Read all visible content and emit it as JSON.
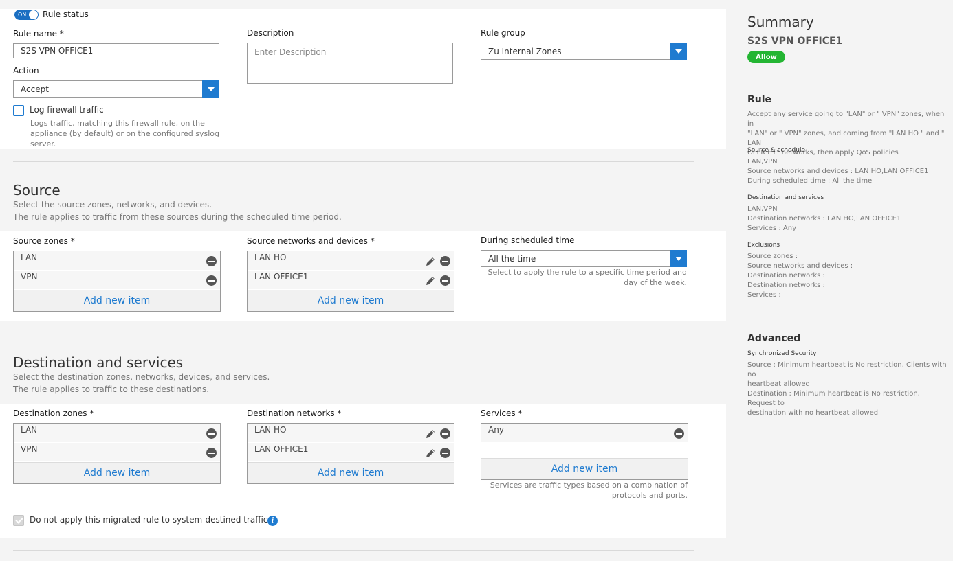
{
  "rule": {
    "status_toggle": "ON",
    "status_label": "Rule status",
    "name_label": "Rule name *",
    "name_value": "S2S VPN OFFICE1",
    "description_label": "Description",
    "description_placeholder": "Enter Description",
    "group_label": "Rule group",
    "group_value": "Zu Internal Zones",
    "action_label": "Action",
    "action_value": "Accept",
    "log_label": "Log firewall traffic",
    "log_hint": "Logs traffic, matching this firewall rule, on the appliance (by default) or on the configured syslog server."
  },
  "source": {
    "title": "Source",
    "desc1": "Select the source zones, networks, and devices.",
    "desc2": "The rule applies to traffic from these sources during the scheduled time period.",
    "zones_label": "Source zones *",
    "zones": [
      "LAN",
      "VPN"
    ],
    "networks_label": "Source networks and devices *",
    "networks": [
      "LAN HO",
      "LAN OFFICE1"
    ],
    "schedule_label": "During scheduled time",
    "schedule_value": "All the time",
    "schedule_hint1": "Select to apply the rule to a specific time period and",
    "schedule_hint2": "day of the week.",
    "add_item": "Add new item"
  },
  "destination": {
    "title": "Destination and services",
    "desc1": "Select the destination zones, networks, devices, and services.",
    "desc2": "The rule applies to traffic to these destinations.",
    "zones_label": "Destination zones *",
    "zones": [
      "LAN",
      "VPN"
    ],
    "networks_label": "Destination networks *",
    "networks": [
      "LAN HO",
      "LAN OFFICE1"
    ],
    "services_label": "Services *",
    "services": [
      "Any"
    ],
    "services_hint1": "Services are traffic types based on a combination of",
    "services_hint2": "protocols and ports.",
    "add_item": "Add new item",
    "migrated_label": "Do not apply this migrated rule to system-destined traffic.",
    "info_glyph": "i"
  },
  "summary": {
    "title": "Summary",
    "rule_name": "S2S VPN OFFICE1",
    "badge": "Allow",
    "rule_heading": "Rule",
    "rule_text": [
      "Accept any service going to \"LAN\" or \" VPN\" zones, when in",
      "\"LAN\" or \" VPN\" zones, and coming from \"LAN HO \" and \" LAN",
      "OFFICE1\" networks, then apply QoS policies"
    ],
    "source_heading": "Source & schedule",
    "source_text": [
      "LAN,VPN",
      "Source networks and devices : LAN HO,LAN OFFICE1",
      "During scheduled time : All the time"
    ],
    "dest_heading": "Destination and services",
    "dest_text": [
      "LAN,VPN",
      "Destination networks : LAN HO,LAN OFFICE1",
      "Services : Any"
    ],
    "excl_heading": "Exclusions",
    "excl_text": [
      "Source zones :",
      "Source networks and devices :",
      "Destination networks :",
      "Destination networks :",
      "Services :"
    ],
    "advanced_heading": "Advanced",
    "sync_heading": "Synchronized Security",
    "sync_text": [
      "Source : Minimum heartbeat is No restriction, Clients with no",
      "heartbeat allowed",
      "Destination : Minimum heartbeat is No restriction, Request to",
      "destination with no heartbeat allowed"
    ]
  },
  "colors": {
    "accent": "#1f7bd0",
    "allow": "#24b533"
  }
}
